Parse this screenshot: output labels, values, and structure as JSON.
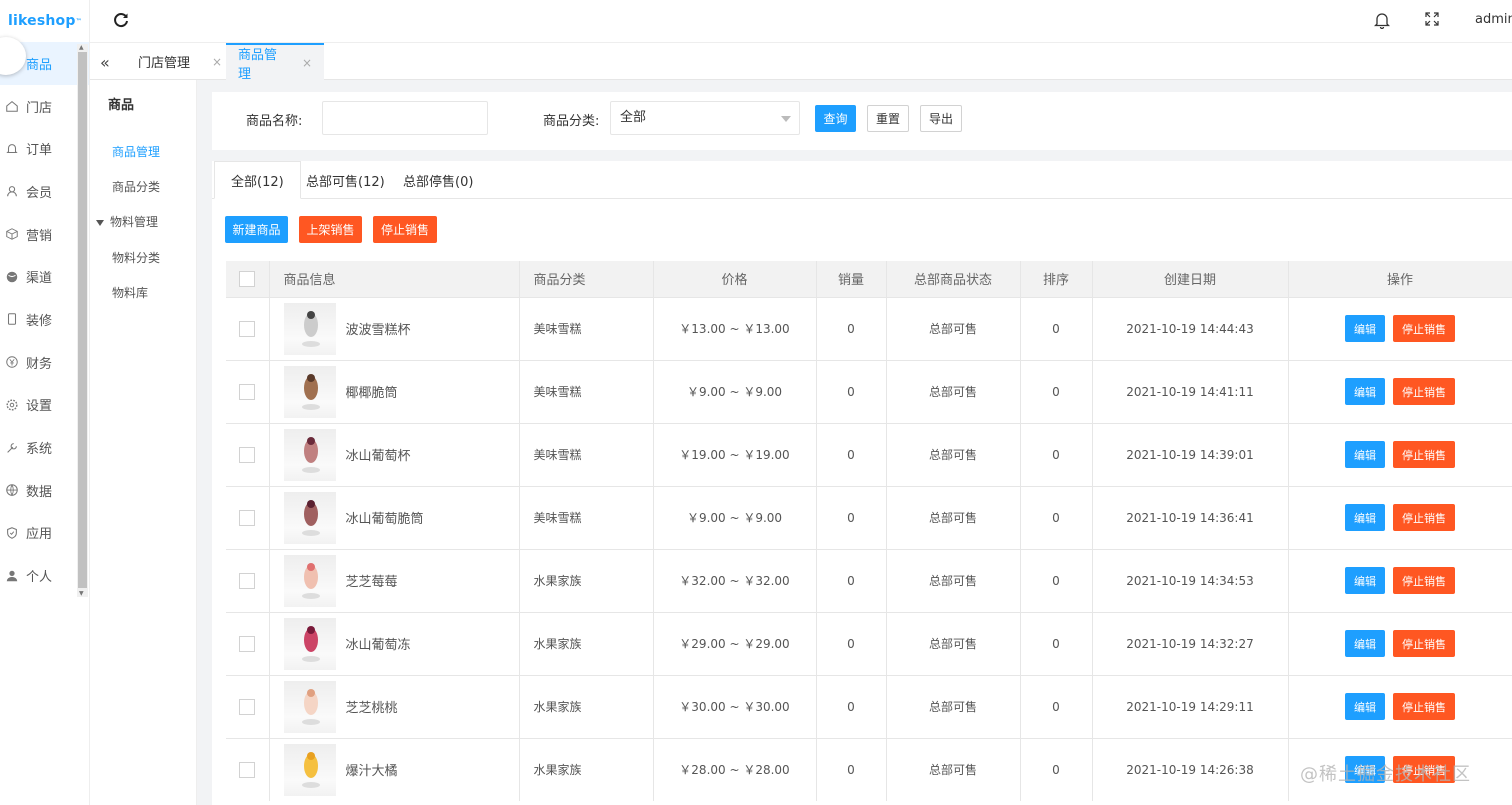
{
  "brand": {
    "logo": "likeshop",
    "tm": "™"
  },
  "sidebar": {
    "items": [
      {
        "label": "商品",
        "icon": "bag-icon",
        "active": true
      },
      {
        "label": "门店",
        "icon": "home-icon"
      },
      {
        "label": "订单",
        "icon": "bell-icon"
      },
      {
        "label": "会员",
        "icon": "user-icon"
      },
      {
        "label": "营销",
        "icon": "cube-icon"
      },
      {
        "label": "渠道",
        "icon": "globe-icon"
      },
      {
        "label": "装修",
        "icon": "tablet-icon"
      },
      {
        "label": "财务",
        "icon": "yen-icon"
      },
      {
        "label": "设置",
        "icon": "gear-icon"
      },
      {
        "label": "系统",
        "icon": "wrench-icon"
      },
      {
        "label": "数据",
        "icon": "chart-icon"
      },
      {
        "label": "应用",
        "icon": "shield-icon"
      },
      {
        "label": "个人",
        "icon": "person-icon"
      }
    ]
  },
  "header": {
    "user": "admin"
  },
  "tabs": [
    {
      "label": "门店管理",
      "close": "×"
    },
    {
      "label": "商品管理",
      "close": "×"
    }
  ],
  "subnav": {
    "title": "商品",
    "items": [
      "商品管理",
      "商品分类"
    ],
    "group": "物料管理",
    "group_items": [
      "物料分类",
      "物料库"
    ]
  },
  "filter": {
    "name_label": "商品名称:",
    "name_value": "",
    "category_label": "商品分类:",
    "category_value": "全部",
    "search": "查询",
    "reset": "重置",
    "export": "导出"
  },
  "status_tabs": [
    "全部(12)",
    "总部可售(12)",
    "总部停售(0)"
  ],
  "actions": {
    "new": "新建商品",
    "on_sale": "上架销售",
    "stop_sale": "停止销售"
  },
  "table": {
    "columns": [
      "商品信息",
      "商品分类",
      "价格",
      "销量",
      "总部商品状态",
      "排序",
      "创建日期",
      "操作"
    ],
    "row_actions": {
      "edit": "编辑",
      "stop": "停止销售"
    },
    "rows": [
      {
        "name": "波波雪糕杯",
        "category": "美味雪糕",
        "price": "￥13.00 ~ ￥13.00",
        "sales": "0",
        "status": "总部可售",
        "sort": "0",
        "date": "2021-10-19 14:44:43"
      },
      {
        "name": "椰椰脆筒",
        "category": "美味雪糕",
        "price": "￥9.00 ~ ￥9.00",
        "sales": "0",
        "status": "总部可售",
        "sort": "0",
        "date": "2021-10-19 14:41:11"
      },
      {
        "name": "冰山葡萄杯",
        "category": "美味雪糕",
        "price": "￥19.00 ~ ￥19.00",
        "sales": "0",
        "status": "总部可售",
        "sort": "0",
        "date": "2021-10-19 14:39:01"
      },
      {
        "name": "冰山葡萄脆筒",
        "category": "美味雪糕",
        "price": "￥9.00 ~ ￥9.00",
        "sales": "0",
        "status": "总部可售",
        "sort": "0",
        "date": "2021-10-19 14:36:41"
      },
      {
        "name": "芝芝莓莓",
        "category": "水果家族",
        "price": "￥32.00 ~ ￥32.00",
        "sales": "0",
        "status": "总部可售",
        "sort": "0",
        "date": "2021-10-19 14:34:53"
      },
      {
        "name": "冰山葡萄冻",
        "category": "水果家族",
        "price": "￥29.00 ~ ￥29.00",
        "sales": "0",
        "status": "总部可售",
        "sort": "0",
        "date": "2021-10-19 14:32:27"
      },
      {
        "name": "芝芝桃桃",
        "category": "水果家族",
        "price": "￥30.00 ~ ￥30.00",
        "sales": "0",
        "status": "总部可售",
        "sort": "0",
        "date": "2021-10-19 14:29:11"
      },
      {
        "name": "爆汁大橘",
        "category": "水果家族",
        "price": "￥28.00 ~ ￥28.00",
        "sales": "0",
        "status": "总部可售",
        "sort": "0",
        "date": "2021-10-19 14:26:38"
      }
    ]
  },
  "watermark": "@稀土掘金技术社区",
  "colors": {
    "primary": "#1e9fff",
    "danger": "#ff5722"
  }
}
